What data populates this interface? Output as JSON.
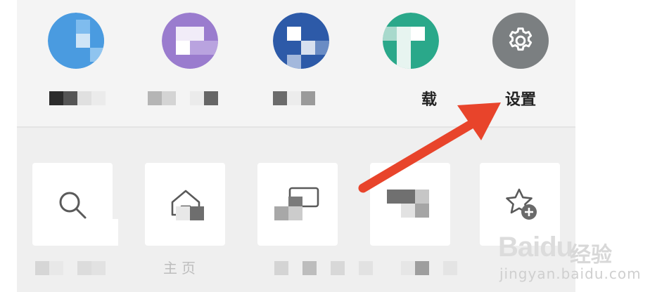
{
  "apps": [
    {
      "label": "",
      "icon": "app-blue-icon",
      "color": "#4a9be0"
    },
    {
      "label": "",
      "icon": "app-purple-icon",
      "color": "#9a7cce"
    },
    {
      "label": "",
      "icon": "app-navy-icon",
      "color": "#2d5aa8"
    },
    {
      "label": "载",
      "icon": "app-green-icon",
      "color": "#2aa88a"
    },
    {
      "label": "设置",
      "icon": "gear-icon",
      "color": "#7b7f81"
    }
  ],
  "tools": [
    {
      "icon": "search-icon"
    },
    {
      "icon": "home-icon"
    },
    {
      "icon": "window-icon"
    },
    {
      "icon": "pixelated-icon"
    },
    {
      "icon": "star-add-icon"
    }
  ],
  "tool_label_fragment": "主页",
  "watermark": {
    "logo": "Baidu",
    "cn": "经验",
    "url": "jingyan.baidu.com"
  }
}
